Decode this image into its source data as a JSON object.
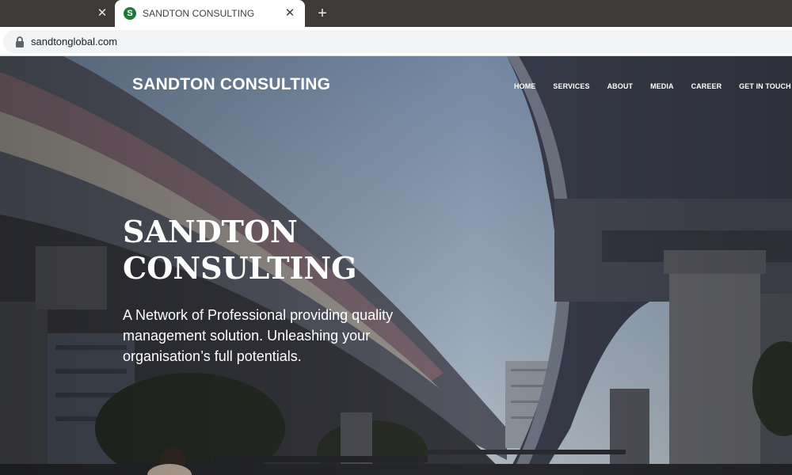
{
  "browser": {
    "tabs": [
      {
        "title": ""
      },
      {
        "title": "SANDTON CONSULTING",
        "favicon_letter": "S"
      }
    ],
    "new_tab_symbol": "+",
    "close_symbol": "✕",
    "url": "sandtonglobal.com"
  },
  "site": {
    "brand": "SANDTON CONSULTING",
    "nav": [
      "HOME",
      "SERVICES",
      "ABOUT",
      "MEDIA",
      "CAREER",
      "GET IN TOUCH"
    ],
    "hero": {
      "title": "SANDTON CONSULTING",
      "subtitle": "A Network of Professional providing quality management solution. Unleashing your organisation’s full potentials."
    }
  },
  "colors": {
    "tabstrip": "#3c3b37",
    "favicon": "#1f7a3a",
    "sky": "#8fa7c2",
    "overpass": "#4a4f5e"
  }
}
